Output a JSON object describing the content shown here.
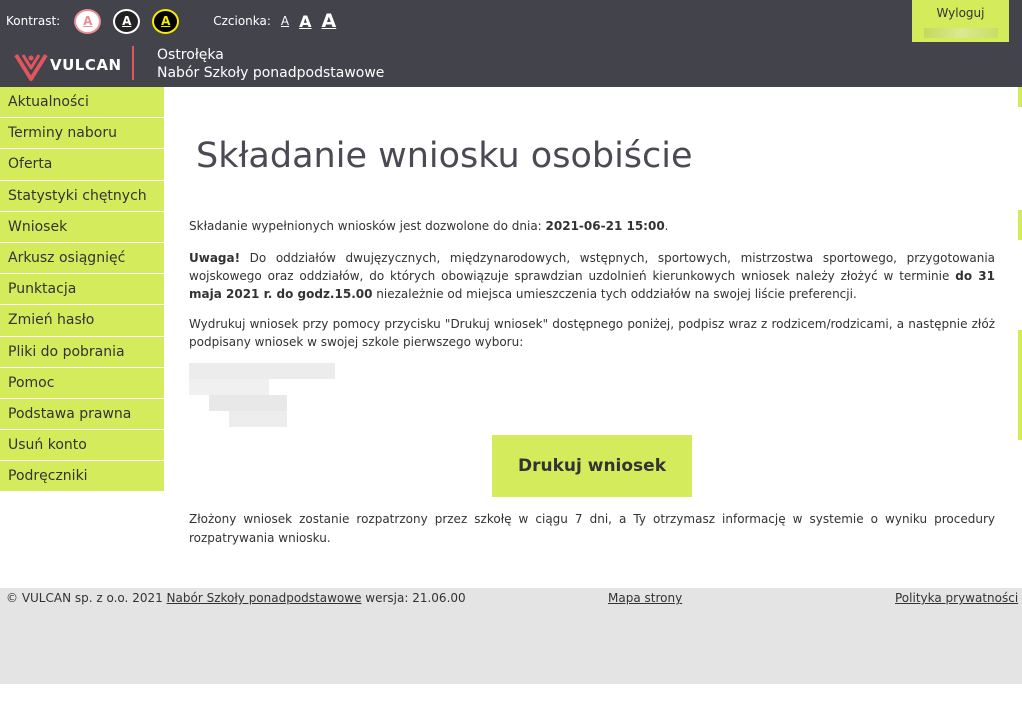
{
  "accessibility": {
    "kontrast_label": "Kontrast:",
    "kontrast_buttons": [
      "A",
      "A",
      "A"
    ],
    "font_label": "Czcionka:",
    "font_buttons": [
      "A",
      "A",
      "A"
    ]
  },
  "header": {
    "logout_label": "Wyloguj",
    "logo_text": "VULCAN",
    "city": "Ostrołęka",
    "subtitle": "Nabór Szkoły ponadpodstawowe"
  },
  "sidebar": {
    "items": [
      {
        "label": "Aktualności"
      },
      {
        "label": "Terminy naboru"
      },
      {
        "label": "Oferta"
      },
      {
        "label": "Statystyki chętnych"
      },
      {
        "label": "Wniosek"
      },
      {
        "label": "Arkusz osiągnięć"
      },
      {
        "label": "Punktacja"
      },
      {
        "label": "Zmień hasło"
      },
      {
        "label": "Pliki do pobrania"
      },
      {
        "label": "Pomoc"
      },
      {
        "label": "Podstawa prawna"
      },
      {
        "label": "Usuń konto"
      },
      {
        "label": "Podręczniki"
      }
    ]
  },
  "main": {
    "title": "Składanie wniosku osobiście",
    "deadline_text": "Składanie wypełnionych wniosków jest dozwolone do dnia: ",
    "deadline_value": "2021-06-21 15:00",
    "deadline_end": ".",
    "warning_label": "Uwaga!",
    "warning_text": " Do oddziałów dwujęzycznych, międzynarodowych, wstępnych, sportowych, mistrzostwa sportowego, przygotowania wojskowego oraz oddziałów, do których obowiązuje sprawdzian uzdolnień kierunkowych wniosek należy złożyć w terminie ",
    "warning_deadline": "do 31 maja 2021 r. do godz.15.00",
    "warning_end": " niezależnie od miejsca umieszczenia tych oddziałów na swojej liście preferencji.",
    "print_instruction": "Wydrukuj wniosek przy pomocy przycisku \"Drukuj wniosek\" dostępnego poniżej, podpisz wraz z rodzicem/rodzicami, a następnie złóż podpisany wniosek w swojej szkole pierwszego wyboru:",
    "print_button": "Drukuj wniosek",
    "after_text": "Złożony wniosek zostanie rozpatrzony przez szkołę w ciągu 7 dni, a Ty otrzymasz informację w systemie o wyniku procedury rozpatrywania wniosku."
  },
  "footer": {
    "copyright": "© VULCAN sp. z o.o. 2021 ",
    "product_link": "Nabór Szkoły ponadpodstawowe",
    "version": " wersja: 21.06.00",
    "sitemap": "Mapa strony",
    "privacy": "Polityka prywatności"
  },
  "colors": {
    "topbar": "#43434b",
    "accent": "#d4ec5b",
    "logo_red": "#e0555e",
    "footer_bg": "#e4e4e4"
  }
}
